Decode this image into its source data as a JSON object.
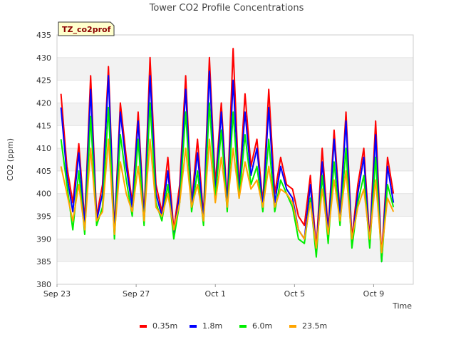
{
  "chart_data": {
    "type": "line",
    "title": "Tower CO2 Profile Concentrations",
    "site_badge": "TZ_co2prof",
    "xlabel": "Time",
    "ylabel": "CO2 (ppm)",
    "x_unit": "days since Sep 23",
    "xlim": [
      0,
      18
    ],
    "ylim": [
      380,
      435
    ],
    "yticks": [
      380,
      385,
      390,
      395,
      400,
      405,
      410,
      415,
      420,
      425,
      430,
      435
    ],
    "xticks": [
      {
        "label": "Sep 23",
        "value": 0
      },
      {
        "label": "Sep 27",
        "value": 4
      },
      {
        "label": "Oct 1",
        "value": 8
      },
      {
        "label": "Oct 5",
        "value": 12
      },
      {
        "label": "Oct 9",
        "value": 16
      }
    ],
    "grid": true,
    "legend_position": "bottom",
    "x": [
      0.2,
      0.5,
      0.8,
      1.1,
      1.4,
      1.7,
      2.0,
      2.3,
      2.6,
      2.9,
      3.2,
      3.5,
      3.8,
      4.1,
      4.4,
      4.7,
      5.0,
      5.3,
      5.6,
      5.9,
      6.2,
      6.5,
      6.8,
      7.1,
      7.4,
      7.7,
      8.0,
      8.3,
      8.6,
      8.9,
      9.2,
      9.5,
      9.8,
      10.1,
      10.4,
      10.7,
      11.0,
      11.3,
      11.6,
      11.9,
      12.2,
      12.5,
      12.8,
      13.1,
      13.4,
      13.7,
      14.0,
      14.3,
      14.6,
      14.9,
      15.2,
      15.5,
      15.8,
      16.1,
      16.4,
      16.7,
      17.0
    ],
    "series": [
      {
        "name": "0.35m",
        "color": "#ff0000",
        "values": [
          422,
          406,
          398,
          411,
          394,
          426,
          395,
          402,
          428,
          392,
          420,
          408,
          398,
          418,
          395,
          430,
          402,
          396,
          408,
          392,
          402,
          426,
          398,
          412,
          395,
          430,
          402,
          420,
          398,
          432,
          401,
          422,
          406,
          412,
          398,
          423,
          400,
          408,
          402,
          401,
          395,
          393,
          404,
          388,
          410,
          392,
          414,
          396,
          418,
          390,
          402,
          410,
          390,
          416,
          386,
          408,
          400
        ]
      },
      {
        "name": "1.8m",
        "color": "#0000ff",
        "values": [
          419,
          404,
          396,
          409,
          393,
          423,
          394,
          400,
          426,
          391,
          418,
          406,
          397,
          416,
          394,
          426,
          400,
          395,
          405,
          391,
          400,
          423,
          397,
          409,
          394,
          427,
          400,
          418,
          397,
          425,
          400,
          418,
          404,
          410,
          397,
          419,
          398,
          406,
          401,
          399,
          392,
          390,
          402,
          387,
          407,
          391,
          412,
          395,
          416,
          389,
          400,
          408,
          389,
          413,
          385,
          406,
          398
        ]
      },
      {
        "name": "6.0m",
        "color": "#00ee00",
        "values": [
          412,
          402,
          392,
          405,
          391,
          417,
          393,
          397,
          419,
          390,
          413,
          403,
          395,
          412,
          393,
          420,
          398,
          394,
          402,
          390,
          398,
          418,
          396,
          405,
          393,
          420,
          399,
          414,
          396,
          418,
          399,
          413,
          402,
          406,
          396,
          412,
          396,
          403,
          400,
          397,
          390,
          389,
          399,
          386,
          404,
          389,
          407,
          393,
          410,
          388,
          398,
          404,
          388,
          408,
          385,
          402,
          397
        ]
      },
      {
        "name": "23.5m",
        "color": "#ffa500",
        "values": [
          406,
          400,
          394,
          402,
          392,
          410,
          394,
          396,
          412,
          391,
          407,
          400,
          396,
          406,
          394,
          412,
          397,
          395,
          400,
          392,
          398,
          410,
          397,
          402,
          394,
          412,
          398,
          408,
          397,
          410,
          399,
          407,
          401,
          403,
          397,
          406,
          397,
          401,
          400,
          398,
          392,
          390,
          398,
          388,
          401,
          391,
          403,
          394,
          405,
          390,
          397,
          401,
          390,
          403,
          387,
          399,
          396
        ]
      }
    ]
  }
}
